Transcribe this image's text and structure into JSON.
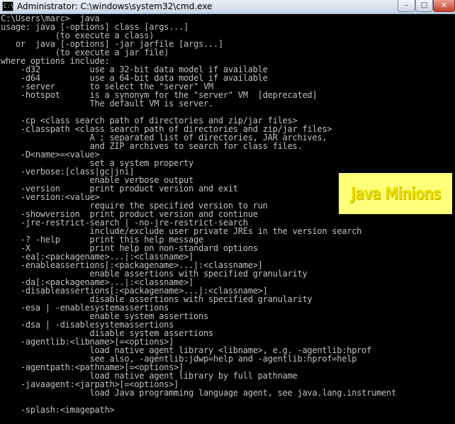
{
  "window": {
    "title": "Administrator: C:\\windows\\system32\\cmd.exe",
    "icon_label": "C:\\",
    "minimize_glyph": "–",
    "maximize_glyph": "□",
    "close_glyph": "✕"
  },
  "console": {
    "text": "C:\\Users\\marc>  java\nusage: java [-options] class [args...]\n           (to execute a class)\n   or  java [-options] -jar jarfile [args...]\n           (to execute a jar file)\nwhere options include:\n    -d32          use a 32-bit data model if available\n    -d64          use a 64-bit data model if available\n    -server       to select the \"server\" VM\n    -hotspot      is a synonym for the \"server\" VM  [deprecated]\n                  The default VM is server.\n\n    -cp <class search path of directories and zip/jar files>\n    -classpath <class search path of directories and zip/jar files>\n                  A ; separated list of directories, JAR archives,\n                  and ZIP archives to search for class files.\n    -D<name>=<value>\n                  set a system property\n    -verbose:[class|gc|jni]\n                  enable verbose output\n    -version      print product version and exit\n    -version:<value>\n                  require the specified version to run\n    -showversion  print product version and continue\n    -jre-restrict-search | -no-jre-restrict-search\n                  include/exclude user private JREs in the version search\n    -? -help      print this help message\n    -X            print help on non-standard options\n    -ea[:<packagename>...|:<classname>]\n    -enableassertions[:<packagename>...|:<classname>]\n                  enable assertions with specified granularity\n    -da[:<packagename>...|:<classname>]\n    -disableassertions[:<packagename>...|:<classname>]\n                  disable assertions with specified granularity\n    -esa | -enablesystemassertions\n                  enable system assertions\n    -dsa | -disablesystemassertions\n                  disable system assertions\n    -agentlib:<libname>[=<options>]\n                  load native agent library <libname>, e.g. -agentlib:hprof\n                  see also, -agentlib:jdwp=help and -agentlib:hprof=help\n    -agentpath:<pathname>[=<options>]\n                  load native agent library by full pathname\n    -javaagent:<jarpath>[=<options>]\n                  load Java programming language agent, see java.lang.instrument\n\n    -splash:<imagepath>"
  },
  "watermark": {
    "text": "Java Minions"
  },
  "colors": {
    "console_background": "#000000",
    "console_text": "#c0c0c0",
    "watermark_background": "#ffff7a",
    "watermark_text": "#eadd00"
  }
}
